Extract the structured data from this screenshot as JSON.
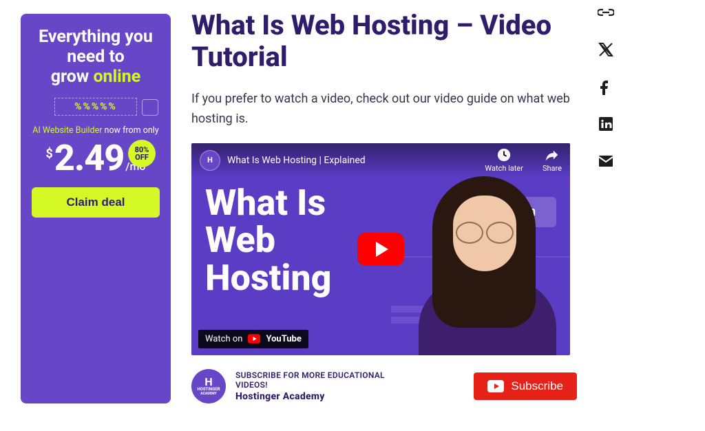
{
  "promo": {
    "headline_line1": "Everything you",
    "headline_line2": "need to",
    "headline_line3_pre": "grow ",
    "headline_line3_accent": "online",
    "coupon_placeholder": "%%%%%",
    "subline_ai": "AI Website Builder",
    "subline_rest": " now from only",
    "currency": "$",
    "price": "2.49",
    "per": "/mo",
    "badge_top": "80%",
    "badge_bottom": "OFF",
    "cta": "Claim deal"
  },
  "article": {
    "heading": "What Is Web Hosting – Video Tutorial",
    "intro": "If you prefer to watch a video, check out our video guide on what web hosting is."
  },
  "video": {
    "channel_avatar_label": "H",
    "title_bar": "What Is Web Hosting | Explained",
    "watch_later": "Watch later",
    "share": "Share",
    "overlay_line1": "What Is",
    "overlay_line2": "Web",
    "overlay_line3": "Hosting",
    "badge_text": ".com",
    "watch_on": "Watch on",
    "youtube_word": "YouTube"
  },
  "subscribe": {
    "avatar_top": "H",
    "avatar_bottom": "HOSTINGER",
    "avatar_sub": "ACADEMY",
    "line1": "SUBSCRIBE FOR MORE EDUCATIONAL VIDEOS!",
    "line2": "Hostinger Academy",
    "button": "Subscribe"
  },
  "social": {
    "link": "link-icon",
    "x": "x-icon",
    "facebook": "facebook-icon",
    "linkedin": "linkedin-icon",
    "email": "email-icon"
  }
}
